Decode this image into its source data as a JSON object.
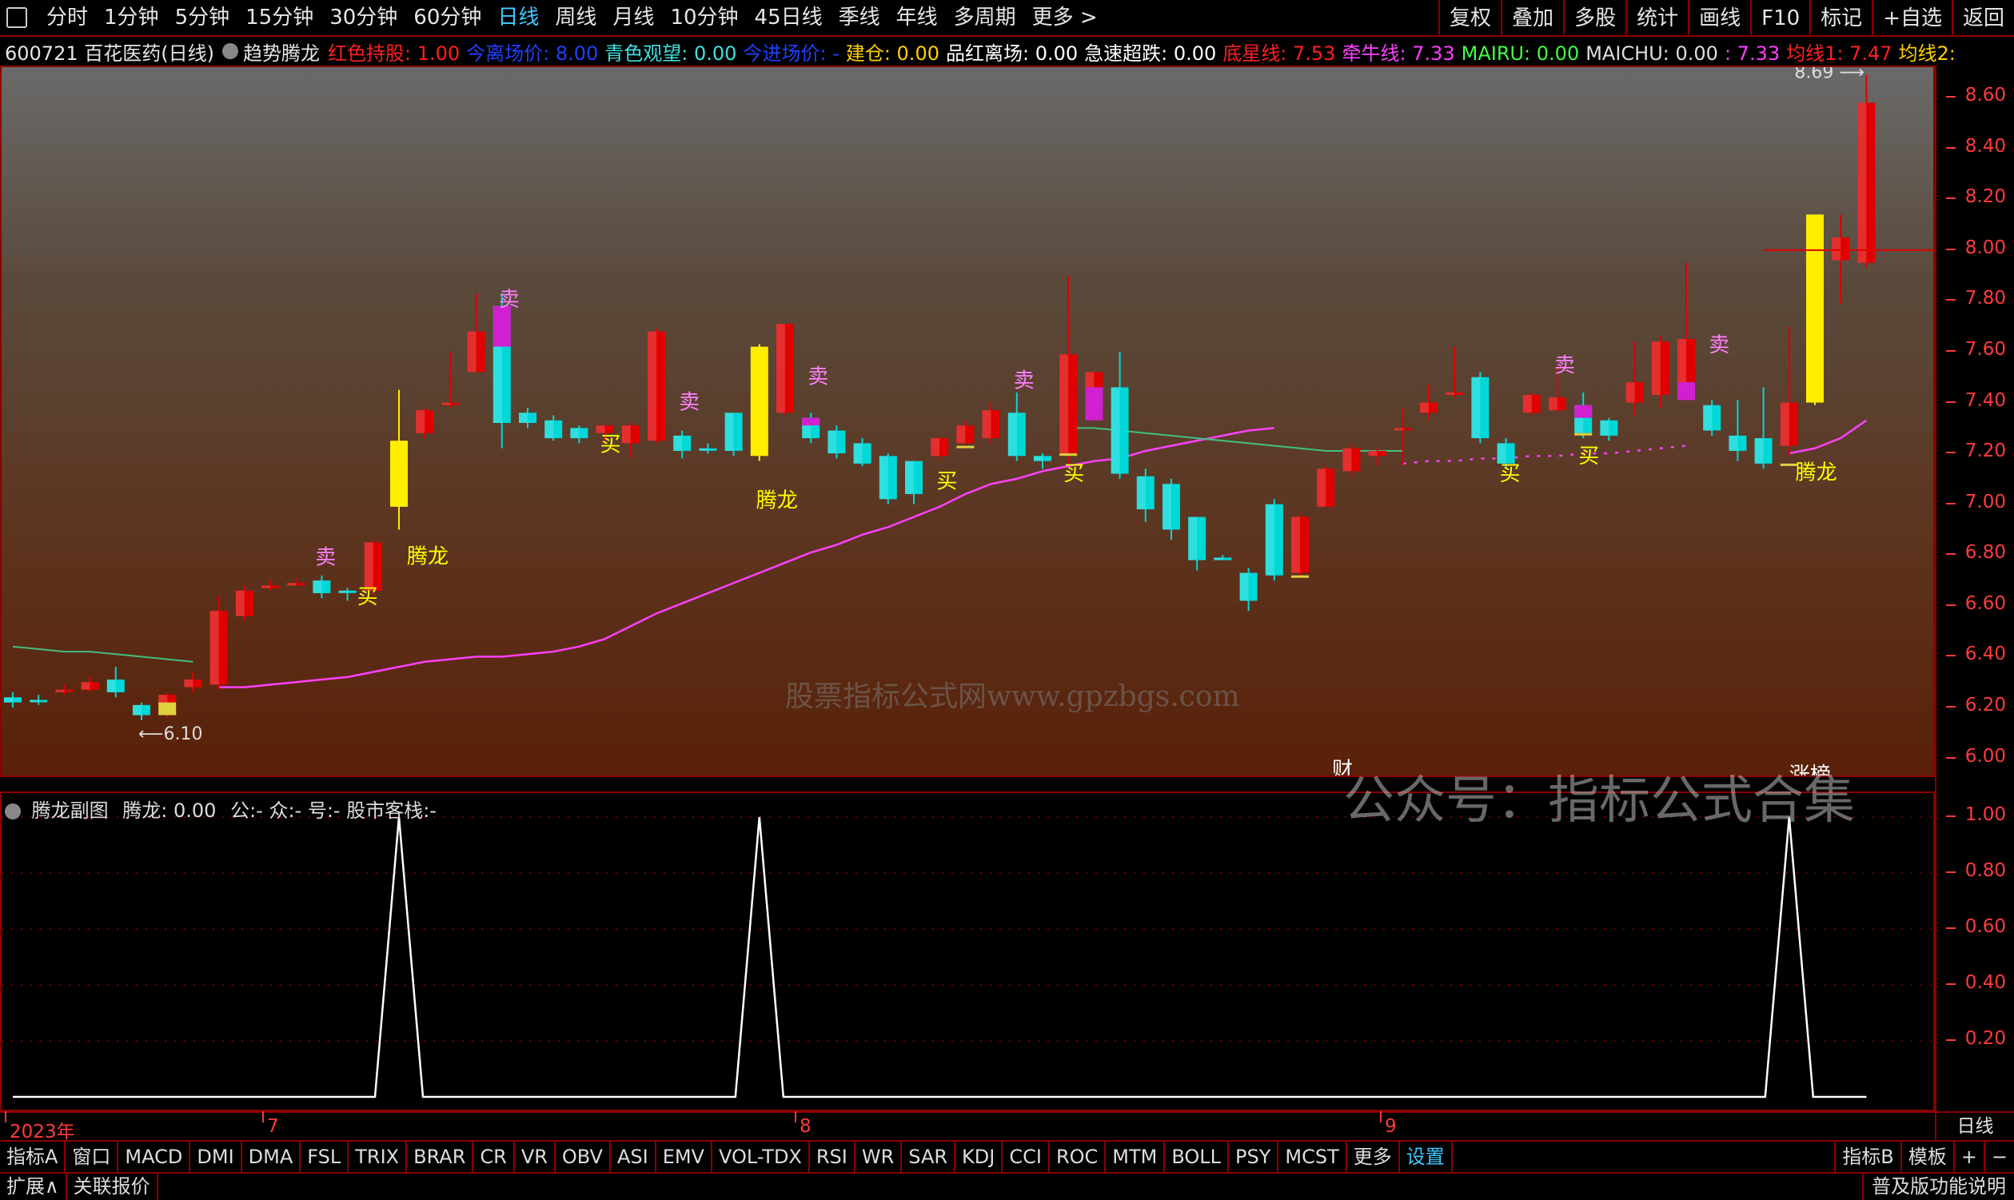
{
  "toolbar": {
    "periods": [
      "分时",
      "1分钟",
      "5分钟",
      "15分钟",
      "30分钟",
      "60分钟",
      "日线",
      "周线",
      "月线",
      "10分钟",
      "45日线",
      "季线",
      "年线",
      "多周期",
      "更多 >"
    ],
    "active_period": "日线",
    "right_buttons": [
      "复权",
      "叠加",
      "多股",
      "统计",
      "画线",
      "F10",
      "标记",
      "+自选",
      "返回"
    ]
  },
  "info": {
    "code_name": "600721 百花医药(日线)",
    "indicator": "趋势腾龙",
    "fields": [
      {
        "label": "红色持股:",
        "value": "1.00",
        "color": "#ff2020"
      },
      {
        "label": "今离场价:",
        "value": "8.00",
        "color": "#2040ff"
      },
      {
        "label": "青色观望:",
        "value": "0.00",
        "color": "#40e0e0"
      },
      {
        "label": "今进场价:",
        "value": "-",
        "color": "#2040ff"
      },
      {
        "label": "建仓:",
        "value": "0.00",
        "color": "#ffd000"
      },
      {
        "label": "品红离场:",
        "value": "0.00",
        "color": "#ffffff"
      },
      {
        "label": "急速超跌:",
        "value": "0.00",
        "color": "#ffffff"
      },
      {
        "label": "底星线:",
        "value": "7.53",
        "color": "#ff2020"
      },
      {
        "label": "牵牛线:",
        "value": "7.33",
        "color": "#ff40ff"
      },
      {
        "label": "MAIRU:",
        "value": "0.00",
        "color": "#40ff40"
      },
      {
        "label": "MAICHU:",
        "value": "0.00",
        "color": "#dddddd"
      },
      {
        "label": ":",
        "value": "7.33",
        "color": "#ff40ff"
      },
      {
        "label": "均线1:",
        "value": "7.47",
        "color": "#ff2020"
      },
      {
        "label": "均线2:",
        "value": "",
        "color": "#ffd000"
      }
    ]
  },
  "main_chart": {
    "y_ticks": [
      "8.60",
      "8.40",
      "8.20",
      "8.00",
      "7.80",
      "7.60",
      "7.40",
      "7.20",
      "7.00",
      "6.80",
      "6.60",
      "6.40",
      "6.20",
      "6.00"
    ],
    "y_range": [
      5.92,
      8.72
    ],
    "high_label": "8.69",
    "low_label": "6.10",
    "watermark": "股票指标公式网www.gpzbgs.com",
    "annotations": [
      {
        "text": "卖",
        "color": "#ff80ff"
      },
      {
        "text": "买",
        "color": "#ffff00"
      },
      {
        "text": "腾龙",
        "color": "#ffff00"
      },
      {
        "text": "涨榜",
        "color": "#ffffff"
      },
      {
        "text": "财",
        "color": "#ffffff"
      }
    ],
    "candles": [
      [
        6.22,
        6.24,
        6.2,
        6.26,
        "c"
      ],
      [
        6.23,
        6.23,
        6.21,
        6.25,
        "c"
      ],
      [
        6.27,
        6.27,
        6.25,
        6.29,
        "r"
      ],
      [
        6.27,
        6.3,
        6.26,
        6.32,
        "r"
      ],
      [
        6.31,
        6.26,
        6.24,
        6.36,
        "c"
      ],
      [
        6.21,
        6.17,
        6.15,
        6.22,
        "c"
      ],
      [
        6.17,
        6.25,
        6.16,
        6.26,
        "r"
      ],
      [
        6.28,
        6.31,
        6.26,
        6.34,
        "r"
      ],
      [
        6.29,
        6.58,
        6.27,
        6.64,
        "r"
      ],
      [
        6.56,
        6.66,
        6.54,
        6.68,
        "r"
      ],
      [
        6.67,
        6.68,
        6.66,
        6.7,
        "r"
      ],
      [
        6.69,
        6.69,
        6.68,
        6.71,
        "r"
      ],
      [
        6.7,
        6.65,
        6.63,
        6.72,
        "c"
      ],
      [
        6.66,
        6.66,
        6.62,
        6.67,
        "c"
      ],
      [
        6.66,
        6.85,
        6.64,
        6.86,
        "r"
      ],
      [
        6.99,
        7.25,
        6.9,
        7.45,
        "y"
      ],
      [
        7.28,
        7.37,
        7.26,
        7.38,
        "r"
      ],
      [
        7.4,
        7.4,
        7.38,
        7.6,
        "r"
      ],
      [
        7.52,
        7.68,
        7.52,
        7.83,
        "r"
      ],
      [
        7.78,
        7.32,
        7.22,
        7.83,
        "c"
      ],
      [
        7.36,
        7.32,
        7.3,
        7.38,
        "c"
      ],
      [
        7.33,
        7.26,
        7.25,
        7.35,
        "c"
      ],
      [
        7.3,
        7.26,
        7.24,
        7.31,
        "c"
      ],
      [
        7.31,
        7.28,
        7.24,
        7.31,
        "r"
      ],
      [
        7.24,
        7.31,
        7.18,
        7.32,
        "r"
      ],
      [
        7.25,
        7.68,
        7.24,
        7.69,
        "r"
      ],
      [
        7.27,
        7.21,
        7.18,
        7.29,
        "c"
      ],
      [
        7.22,
        7.22,
        7.2,
        7.24,
        "c"
      ],
      [
        7.21,
        7.36,
        7.19,
        7.36,
        "c"
      ],
      [
        7.19,
        7.62,
        7.17,
        7.63,
        "y"
      ],
      [
        7.36,
        7.71,
        7.35,
        7.71,
        "r"
      ],
      [
        7.34,
        7.26,
        7.24,
        7.36,
        "c"
      ],
      [
        7.29,
        7.2,
        7.18,
        7.31,
        "c"
      ],
      [
        7.24,
        7.16,
        7.15,
        7.26,
        "c"
      ],
      [
        7.19,
        7.02,
        7.0,
        7.2,
        "c"
      ],
      [
        7.17,
        7.04,
        7.0,
        7.17,
        "c"
      ],
      [
        7.19,
        7.26,
        7.17,
        7.27,
        "r"
      ],
      [
        7.24,
        7.31,
        7.22,
        7.33,
        "r"
      ],
      [
        7.26,
        7.37,
        7.24,
        7.4,
        "r"
      ],
      [
        7.36,
        7.19,
        7.17,
        7.44,
        "c"
      ],
      [
        7.19,
        7.17,
        7.14,
        7.2,
        "c"
      ],
      [
        7.2,
        7.59,
        7.16,
        7.9,
        "r"
      ],
      [
        7.52,
        7.46,
        7.43,
        7.52,
        "r"
      ],
      [
        7.46,
        7.12,
        7.1,
        7.6,
        "c"
      ],
      [
        7.11,
        6.98,
        6.93,
        7.14,
        "c"
      ],
      [
        7.08,
        6.9,
        6.86,
        7.1,
        "c"
      ],
      [
        6.95,
        6.78,
        6.74,
        6.95,
        "c"
      ],
      [
        6.79,
        6.78,
        6.78,
        6.8,
        "c"
      ],
      [
        6.73,
        6.62,
        6.58,
        6.75,
        "c"
      ],
      [
        6.72,
        7.0,
        6.7,
        7.02,
        "c"
      ],
      [
        6.73,
        6.95,
        6.71,
        6.96,
        "r"
      ],
      [
        6.99,
        7.14,
        6.99,
        7.15,
        "r"
      ],
      [
        7.13,
        7.22,
        7.11,
        7.24,
        "r"
      ],
      [
        7.19,
        7.21,
        7.15,
        7.22,
        "r"
      ],
      [
        7.3,
        7.3,
        7.15,
        7.38,
        "r"
      ],
      [
        7.36,
        7.4,
        7.33,
        7.47,
        "r"
      ],
      [
        7.44,
        7.44,
        7.42,
        7.62,
        "r"
      ],
      [
        7.5,
        7.26,
        7.24,
        7.52,
        "c"
      ],
      [
        7.24,
        7.16,
        7.14,
        7.26,
        "c"
      ],
      [
        7.36,
        7.43,
        7.35,
        7.44,
        "r"
      ],
      [
        7.37,
        7.42,
        7.36,
        7.55,
        "r"
      ],
      [
        7.39,
        7.28,
        7.26,
        7.44,
        "c"
      ],
      [
        7.33,
        7.27,
        7.25,
        7.34,
        "c"
      ],
      [
        7.4,
        7.48,
        7.35,
        7.64,
        "r"
      ],
      [
        7.43,
        7.64,
        7.38,
        7.66,
        "r"
      ],
      [
        7.48,
        7.65,
        7.46,
        7.95,
        "r"
      ],
      [
        7.39,
        7.29,
        7.27,
        7.41,
        "c"
      ],
      [
        7.27,
        7.21,
        7.17,
        7.41,
        "c"
      ],
      [
        7.16,
        7.26,
        7.14,
        7.46,
        "c"
      ],
      [
        7.23,
        7.4,
        7.19,
        7.7,
        "r"
      ],
      [
        7.4,
        8.14,
        7.39,
        8.14,
        "y"
      ],
      [
        7.96,
        8.05,
        7.79,
        8.14,
        "r"
      ],
      [
        7.95,
        8.58,
        7.93,
        8.69,
        "r"
      ]
    ],
    "red_segments": [
      2,
      3,
      6,
      7,
      8,
      9,
      10,
      11,
      14,
      16,
      17,
      18,
      23,
      24,
      25,
      30,
      36,
      37,
      38,
      41,
      42,
      50,
      51,
      52,
      53,
      54,
      55,
      56,
      59,
      60,
      63,
      64,
      65,
      69,
      71,
      72
    ],
    "magenta_caps": {
      "19": [
        7.78,
        7.62
      ],
      "31": [
        7.34,
        7.31
      ],
      "42": [
        7.46,
        7.33
      ],
      "61": [
        7.39,
        7.34
      ],
      "65": [
        7.48,
        7.41
      ]
    },
    "yellow_caps": {
      "6": [
        6.17,
        6.22
      ],
      "37": [
        7.26,
        7.23
      ],
      "41": [
        7.33,
        7.2
      ],
      "50": [
        6.8,
        6.72
      ],
      "61": [
        7.33,
        7.28
      ],
      "69": [
        7.23,
        7.16
      ]
    },
    "ma_pink": [
      6.28,
      6.28,
      6.29,
      6.3,
      6.31,
      6.32,
      6.34,
      6.36,
      6.38,
      6.39,
      6.4,
      6.4,
      6.41,
      6.42,
      6.44,
      6.47,
      6.52,
      6.57,
      6.61,
      6.65,
      6.69,
      6.73,
      6.77,
      6.81,
      6.84,
      6.88,
      6.91,
      6.95,
      6.99,
      7.04,
      7.08,
      7.1,
      7.13,
      7.15,
      7.17,
      7.18,
      7.21,
      7.23,
      7.25,
      7.27,
      7.29,
      7.3
    ],
    "ma_green": [
      6.44,
      6.43,
      6.42,
      6.42,
      6.41,
      6.4,
      6.39,
      6.38
    ]
  },
  "sub_chart": {
    "title": "腾龙副图",
    "value_label": "腾龙: 0.00",
    "extra": "公:- 众:- 号:- 股市客栈:-",
    "y_ticks": [
      "1.00",
      "0.80",
      "0.60",
      "0.40",
      "0.20"
    ],
    "spikes": [
      15,
      29,
      69
    ],
    "watermark": "公众号：指标公式合集"
  },
  "xaxis": {
    "labels": [
      "2023年",
      "7",
      "8",
      "9"
    ],
    "right_label": "日线"
  },
  "tabs": [
    "指标A",
    "窗口",
    "MACD",
    "DMI",
    "DMA",
    "FSL",
    "TRIX",
    "BRAR",
    "CR",
    "VR",
    "OBV",
    "ASI",
    "EMV",
    "VOL-TDX",
    "RSI",
    "WR",
    "SAR",
    "KDJ",
    "CCI",
    "ROC",
    "MTM",
    "BOLL",
    "PSY",
    "MCST",
    "更多",
    "设置"
  ],
  "tabs_right": [
    "指标B",
    "模板",
    "+",
    "−"
  ],
  "status": {
    "left": [
      "扩展∧",
      "关联报价"
    ],
    "right": "普及版功能说明"
  }
}
